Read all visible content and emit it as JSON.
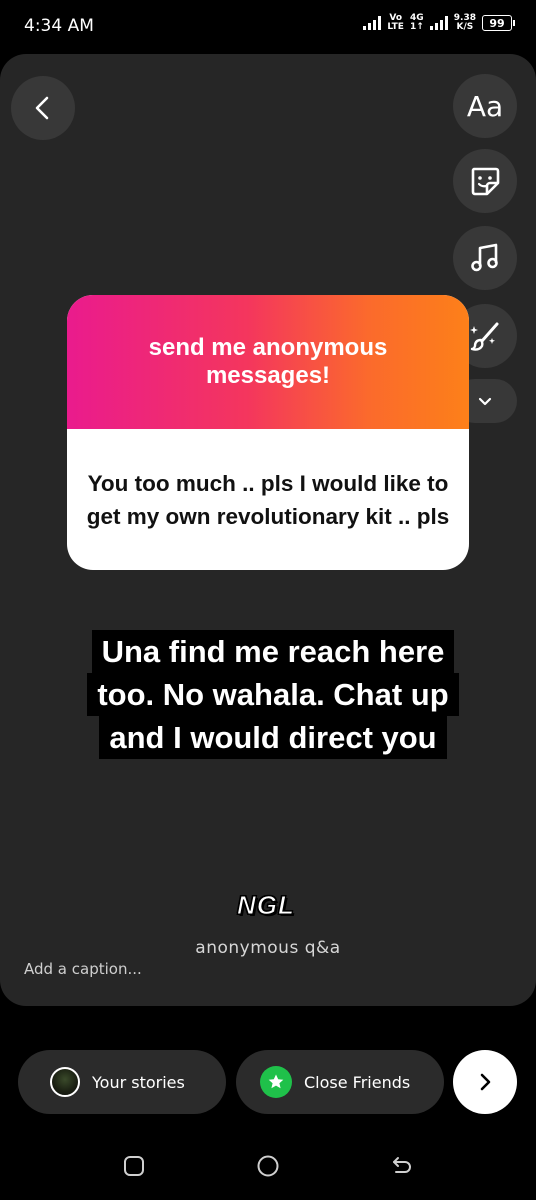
{
  "status_bar": {
    "time": "4:34 AM",
    "volte_top": "Vo",
    "volte_bottom": "LTE",
    "network_top": "4G",
    "network_bottom": "1↑",
    "speed_top": "9.38",
    "speed_bottom": "K/S",
    "battery": "99"
  },
  "toolbar": {
    "text_tool_label": "Aa",
    "icons": [
      "chevron-left-icon",
      "sticker-icon",
      "music-icon",
      "draw-icon",
      "chevron-down-icon"
    ]
  },
  "ngl_card": {
    "header": "send me anonymous messages!",
    "message": "You too much .. pls I would like to get my own revolutionary kit .. pls",
    "gradient": [
      "#ea1b8d",
      "#fd8019"
    ]
  },
  "overlay_text": {
    "lines": [
      "Una find me reach here",
      "too. No wahala. Chat up",
      "and I would direct you"
    ]
  },
  "ngl_branding": {
    "logo": "NGL",
    "subtitle": "anonymous q&a"
  },
  "caption": {
    "placeholder": "Add a caption..."
  },
  "share": {
    "your_stories": "Your stories",
    "close_friends": "Close Friends",
    "close_friends_color": "#1fc14a"
  }
}
